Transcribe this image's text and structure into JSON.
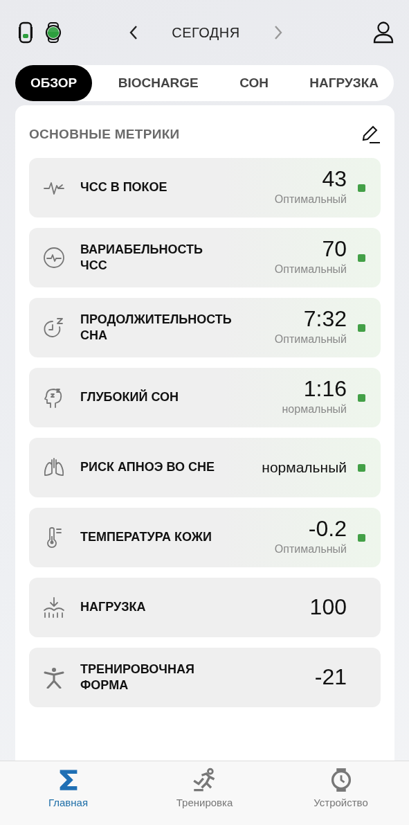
{
  "header": {
    "date": "СЕГОДНЯ"
  },
  "tabs": [
    {
      "label": "ОБЗОР",
      "selected": true
    },
    {
      "label": "BIOCHARGE",
      "selected": false
    },
    {
      "label": "СОН",
      "selected": false
    },
    {
      "label": "НАГРУЗКА",
      "selected": false
    }
  ],
  "section": {
    "title": "ОСНОВНЫЕ МЕТРИКИ"
  },
  "metrics": [
    {
      "label": "ЧСС В ПОКОЕ",
      "value": "43",
      "status": "Оптимальный",
      "color": "#43a047"
    },
    {
      "label": "ВАРИАБЕЛЬНОСТЬ ЧСС",
      "value": "70",
      "status": "Оптимальный",
      "color": "#43a047"
    },
    {
      "label": "ПРОДОЛЖИТЕЛЬНОСТЬ СНА",
      "value": "7:32",
      "status": "Оптимальный",
      "color": "#43a047"
    },
    {
      "label": "ГЛУБОКИЙ СОН",
      "value": "1:16",
      "status": "нормальный",
      "color": "#43a047"
    },
    {
      "label": "РИСК АПНОЭ ВО СНЕ",
      "reading": "нормальный",
      "color": "#43a047"
    },
    {
      "label": "ТЕМПЕРАТУРА КОЖИ",
      "value": "-0.2",
      "status": "Оптимальный",
      "color": "#43a047"
    },
    {
      "label": "НАГРУЗКА",
      "value": "100"
    },
    {
      "label": "ТРЕНИРОВОЧНАЯ ФОРМА",
      "value": "-21"
    }
  ],
  "nav": [
    {
      "label": "Главная",
      "selected": true
    },
    {
      "label": "Тренировка",
      "selected": false
    },
    {
      "label": "Устройство",
      "selected": false
    }
  ]
}
